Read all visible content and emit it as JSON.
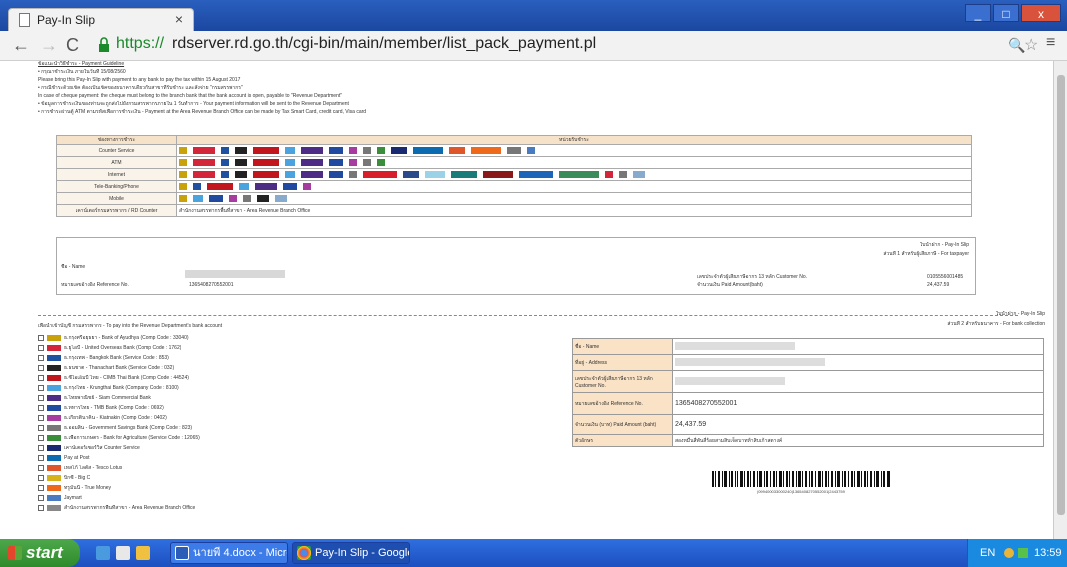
{
  "browser": {
    "tab_title": "Pay-In Slip",
    "tab_close": "×",
    "url_scheme": "https://",
    "url_rest": "rdserver.rd.go.th/cgi-bin/main/member/list_pack_payment.pl",
    "window_buttons": [
      "_",
      "□",
      "x"
    ]
  },
  "instructions": {
    "heading": "ข้อแนะนำวิธีชำระ - Payment Guideline",
    "lines": [
      "• กรุณาชำระเงิน ภายในวันที่ 15/08/2560",
      "Please bring this Pay-In Slip with payment to any bank to pay the tax within 15 August 2017",
      "• กรณีชำระด้วยเช็ค ต้องเป็นเช็คของธนาคารเดียวกับสาขาที่รับชำระ และสั่งจ่าย \"กรมสรรพากร\"",
      "In case of cheque payment: the cheque must belong to the branch bank that the bank account is open, payable to \"Revenue Department\"",
      "• ข้อมูลการชำระเงินของท่านจะถูกส่งไปยังกรมสรรพากรภายใน 1 วันทำการ - Your payment information will be sent to the Revenue Department",
      "• การชำระผ่านตู้ ATM ตามรหัสเพื่อการชำระเงิน - Payment at the Area Revenue Branch Office can be made by Tax Smart Card, credit card, Visa card"
    ]
  },
  "bank_table": {
    "headers": [
      "ช่องทางการชำระ",
      "หน่วยรับชำระ"
    ],
    "rows": [
      {
        "channel": "Counter Service"
      },
      {
        "channel": "ATM"
      },
      {
        "channel": "Internet"
      },
      {
        "channel": "Tele-Banking/Phone"
      },
      {
        "channel": "Mobile"
      },
      {
        "channel": "เคาน์เตอร์กรมสรรพากร / RD Counter",
        "text": "สำนักงานสรรพากรพื้นที่สาขา - Area Revenue Branch Office"
      }
    ]
  },
  "slip_upper": {
    "copy_label": "ส่วนที่ 1 สำหรับผู้เสียภาษี - For taxpayer",
    "copy_title": "ใบนำฝาก - Pay-In Slip",
    "name_label": "ชื่อ - Name",
    "ref_label": "หมายเลขอ้างอิง Reference No.",
    "ref_value": "1365408270552001",
    "customer_label": "เลขประจำตัวผู้เสียภาษีอากร 13 หลัก Customer No.",
    "customer_value": "0105556001485",
    "amount_label": "จำนวนเงิน Paid Amount(baht)",
    "amount_value": "24,437.59"
  },
  "payment_list": {
    "heading": "เพื่อนำเข้าบัญชี กรมสรรพากร - To pay into the Revenue Department's bank account",
    "items": [
      "ธ.กรุงศรีอยุธยา - Bank of Ayudhya (Comp Code : 33040)",
      "ธ.ยูโอบี - United Overseas Bank (Comp Code : 1762)",
      "ธ.กรุงเทพ - Bangkok Bank (Service Code : 853)",
      "ธ.ธนชาต - Thanachart Bank (Service Code : 032)",
      "ธ.ซีไอเอ็มบี ไทย - CIMB Thai Bank (Comp Code : 44524)",
      "ธ.กรุงไทย - Krungthai Bank (Company Code : 8100)",
      "ธ.ไทยพาณิชย์ - Siam Commercial Bank",
      "ธ.ทหารไทย - TMB Bank (Comp Code : 0692)",
      "ธ.เกียรตินาคิน - Kiatnakin (Comp Code : 0402)",
      "ธ.ออมสิน - Government Savings Bank (Comp Code : 823)",
      "ธ.เพื่อการเกษตร - Bank for Agriculture (Service Code : 12065)",
      "เคาน์เตอร์เซอร์วิส Counter Service",
      "Pay at Post",
      "เทสโก้ โลตัส - Tesco Lotus",
      "บิ๊กซี - Big C",
      "ทรูมันนี่ - True Money",
      "Jaymart",
      "สำนักงานสรรพากรพื้นที่สาขา - Area Revenue Branch Office"
    ]
  },
  "slip_lower": {
    "copy_title": "ใบนำฝาก - Pay-In Slip",
    "copy_label": "ส่วนที่ 2 สำหรับธนาคาร - For bank collection",
    "rows": [
      {
        "label": "ชื่อ - Name",
        "value": ""
      },
      {
        "label": "ที่อยู่ - Address",
        "value": ""
      },
      {
        "label": "เลขประจำตัวผู้เสียภาษีอากร 13 หลัก Customer No.",
        "value": ""
      },
      {
        "label": "หมายเลขอ้างอิง Reference No.",
        "value": "1365408270552001"
      },
      {
        "label": "จำนวนเงิน (บาท) Paid Amount (baht)",
        "value": "24,437.59"
      },
      {
        "label": "ตัวอักษร",
        "value": "สองหมื่นสี่พันสี่ร้อยสามสิบเจ็ดบาทห้าสิบเก้าสตางค์"
      }
    ],
    "barcode_number": "|099400033000240|1365408270552001|2443759"
  },
  "taskbar": {
    "start": "start",
    "tasks": [
      "นายพี 4.docx - Micros...",
      "Pay-In Slip - Google C..."
    ],
    "lang": "EN",
    "time": "13:59"
  }
}
